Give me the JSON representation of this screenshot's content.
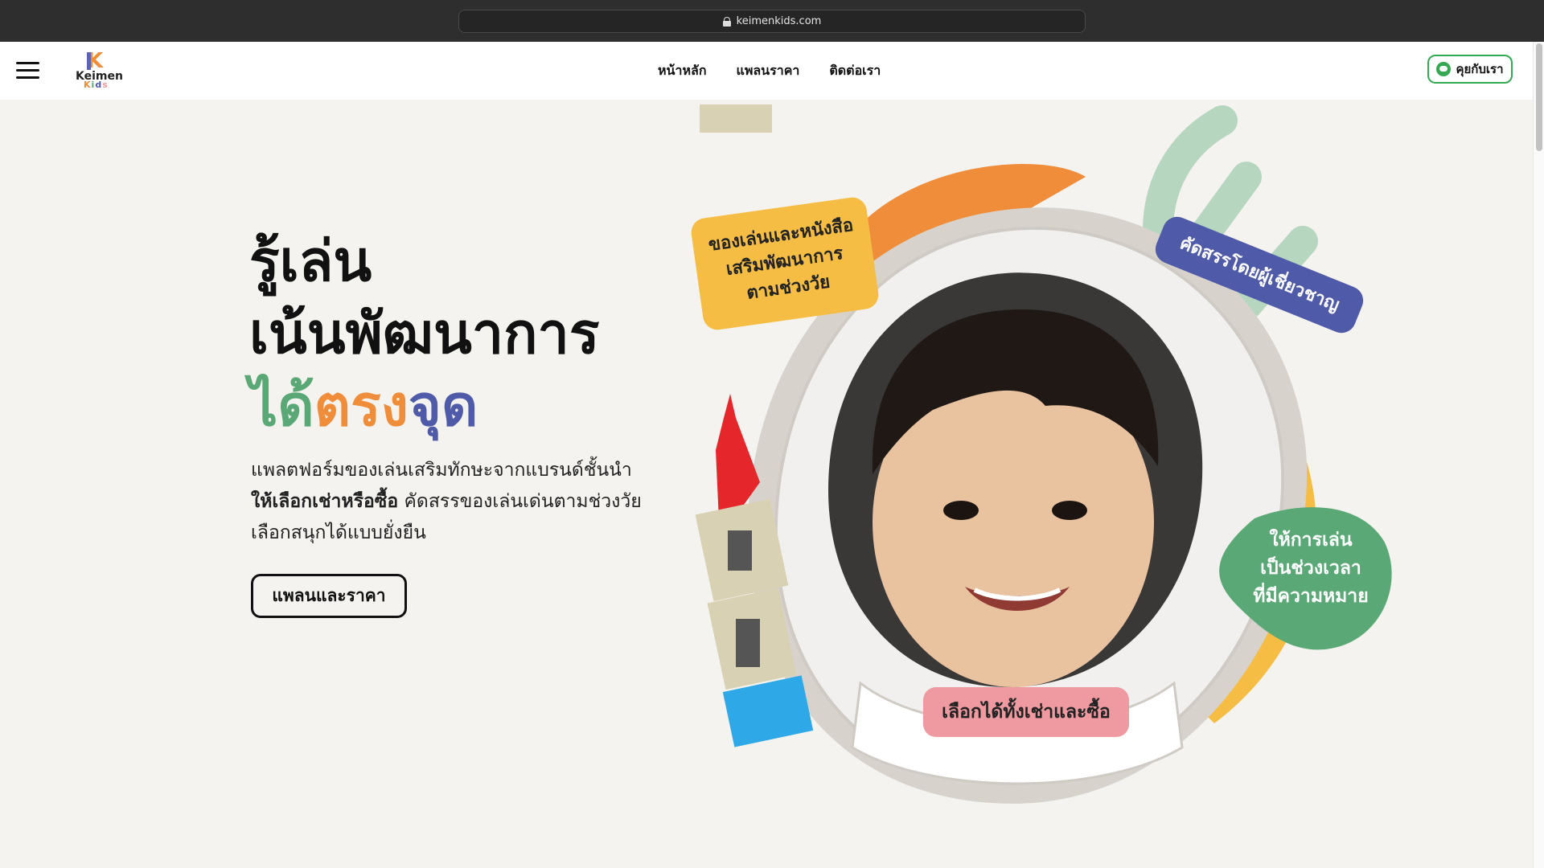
{
  "browser": {
    "url": "keimenkids.com"
  },
  "nav": {
    "logo_top": "Keimen",
    "logo_bottom": "Kids",
    "links": [
      "หน้าหลัก",
      "แพลนราคา",
      "ติดต่อเรา"
    ],
    "chat_button": "คุยกับเรา"
  },
  "hero": {
    "headline_line1": "รู้เล่น",
    "headline_line2": "เน้นพัฒนาการ",
    "headline_word1": "ได้",
    "headline_word2": "ตรง",
    "headline_word3": "จุด",
    "desc_line1": "แพลตฟอร์มของเล่นเสริมทักษะจากแบรนด์ชั้นนำ",
    "desc_bold": "ให้เลือกเช่าหรือซื้อ",
    "desc_line2_rest": " คัดสรรของเล่นเด่นตามช่วงวัย",
    "desc_line3": "เลือกสนุกได้แบบยั่งยืน",
    "cta": "แพลนและราคา"
  },
  "tags": {
    "yellow_l1": "ของเล่นและหนังสือ",
    "yellow_l2": "เสริมพัฒนาการ",
    "yellow_l3": "ตามช่วงวัย",
    "blue": "คัดสรรโดยผู้เชี่ยวชาญ",
    "green_l1": "ให้การเล่น",
    "green_l2": "เป็นช่วงเวลา",
    "green_l3": "ที่มีความหมาย",
    "pink": "เลือกได้ทั้งเช่าและซื้อ"
  },
  "colors": {
    "accent_green": "#5aa875",
    "accent_orange": "#ef8d3a",
    "accent_blue": "#4f5aa8",
    "accent_yellow": "#f6bd45",
    "accent_pink": "#ee9aa0",
    "line_green": "#34a853"
  }
}
